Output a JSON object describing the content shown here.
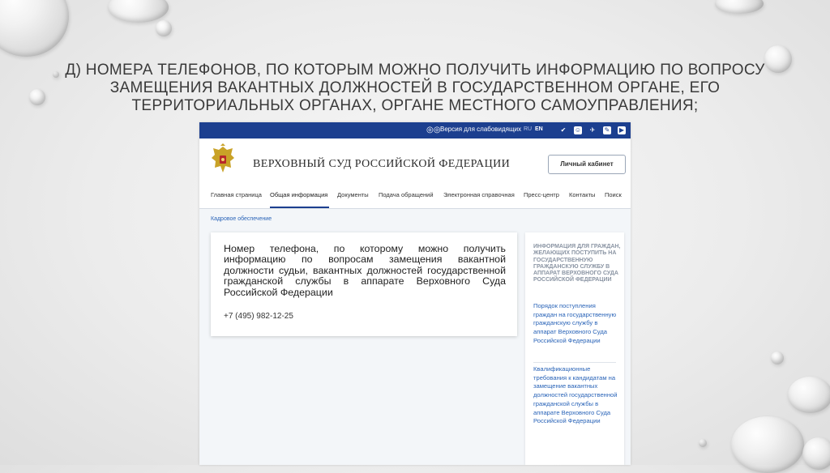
{
  "slide": {
    "title": "Д) НОМЕРА ТЕЛЕФОНОВ, ПО КОТОРЫМ МОЖНО ПОЛУЧИТЬ ИНФОРМАЦИЮ ПО ВОПРОСУ ЗАМЕЩЕНИЯ ВАКАНТНЫХ ДОЛЖНОСТЕЙ В ГОСУДАРСТВЕННОМ ОРГАНЕ, ЕГО ТЕРРИТОРИАЛЬНЫХ ОРГАНАХ, ОРГАНЕ МЕСТНОГО САМОУПРАВЛЕНИЯ;"
  },
  "site": {
    "topbar": {
      "vision_label": "Версия для слабовидящих",
      "lang_ru": "RU",
      "lang_en": "EN",
      "social_icons": [
        "vk-icon",
        "odnoklassniki-icon",
        "twitter-icon",
        "livejournal-icon",
        "youtube-icon"
      ]
    },
    "header": {
      "court_name": "ВЕРХОВНЫЙ СУД РОССИЙСКОЙ ФЕДЕРАЦИИ",
      "cabinet_button": "Личный кабинет"
    },
    "nav": {
      "items": [
        "Главная страница",
        "Общая информация",
        "Документы",
        "Подача обращений",
        "Электронная справочная",
        "Пресс-центр",
        "Контакты",
        "Поиск"
      ],
      "active_index": 1
    },
    "breadcrumb": "Кадровое обеспечение",
    "card": {
      "text": "Номер телефона, по которому можно получить информацию по вопросам замещения вакантной должности судьи, вакантных должностей государственной гражданской службы в аппарате Верховного Суда Российской Федерации",
      "phone": "+7 (495) 982-12-25"
    },
    "sidebar": {
      "heading": "ИНФОРМАЦИЯ ДЛЯ ГРАЖДАН, ЖЕЛАЮЩИХ ПОСТУПИТЬ НА ГОСУДАРСТВЕННУЮ ГРАЖДАНСКУЮ СЛУЖБУ В АППАРАТ ВЕРХОВНОГО СУДА РОССИЙСКОЙ ФЕДЕРАЦИИ",
      "links": [
        "Порядок поступления граждан на государственную гражданскую службу в аппарат Верховного Суда Российской Федерации",
        "Квалификационные требования к кандидатам на замещение вакантных должностей государственной гражданской службы в аппарате Верховного Суда Российской Федерации"
      ]
    },
    "colors": {
      "topbar": "#1c3f8f",
      "link": "#2a64b8"
    }
  }
}
